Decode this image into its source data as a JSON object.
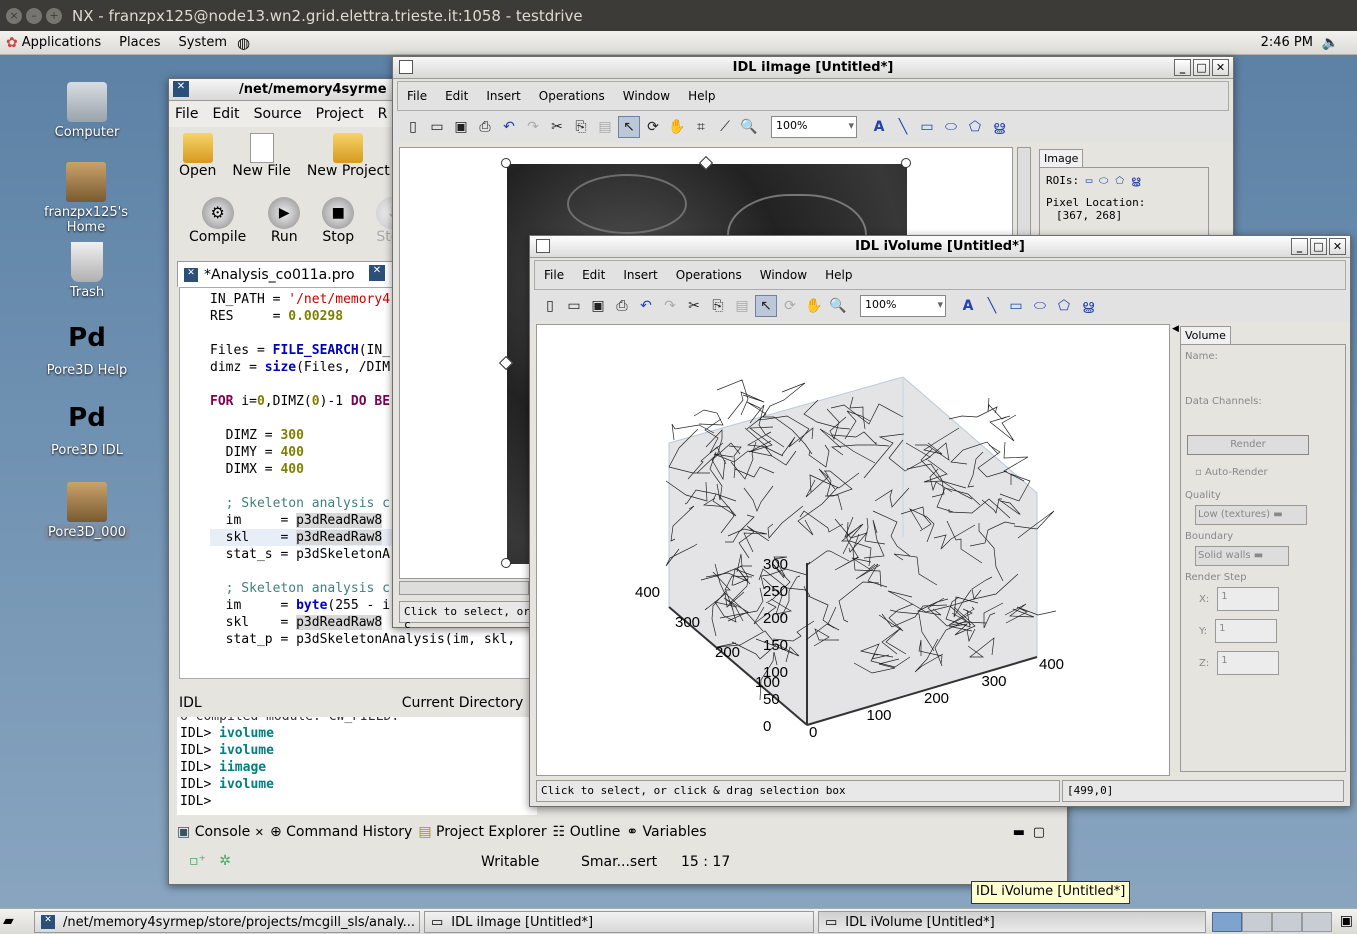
{
  "nx": {
    "title": "NX - franzpx125@node13.wn2.grid.elettra.trieste.it:1058 - testdrive"
  },
  "topbar": {
    "menus": [
      "Applications",
      "Places",
      "System"
    ],
    "clock": "2:46 PM"
  },
  "desktop": {
    "icons": [
      "Computer",
      "franzpx125's Home",
      "Trash",
      "Pore3D Help",
      "Pore3D IDL",
      "Pore3D_000"
    ]
  },
  "eclipse": {
    "title": "/net/memory4syrme",
    "menus": [
      "File",
      "Edit",
      "Source",
      "Project",
      "R"
    ],
    "tools1": [
      "Open",
      "New File",
      "New Project"
    ],
    "tools2": [
      "Compile",
      "Run",
      "Stop",
      "Step"
    ],
    "tab": "*Analysis_co011a.pro",
    "code": {
      "l1a": "IN_PATH = ",
      "l1b": "'/net/memory4",
      "l2a": "RES     = ",
      "l2b": "0.00298",
      "l3a": "Files = ",
      "l3b": "FILE_SEARCH",
      "l3c": "(IN_",
      "l4a": "dimz = ",
      "l4b": "size",
      "l4c": "(Files, /DIM",
      "l5a": "FOR",
      "l5b": " i=",
      "l5c": "0",
      ",l5d": "",
      "l5e": ",DIMZ(",
      "l5f": "0",
      "l5g": ")-1 ",
      "l5h": "DO BE",
      "l6a": "  DIMZ = ",
      "l6b": "300",
      "l7a": "  DIMY = ",
      "l7b": "400",
      "l8a": "  DIMX = ",
      "l8b": "400",
      "l9": "  ; Skeleton analysis c",
      "l10a": "  im     = ",
      "l10b": "p3dReadRaw8",
      "l11a": "  skl    = ",
      "l11b": "p3dReadRaw8",
      "l12": "  stat_s = p3dSkeletonA",
      "l13": "  ; Skeleton analysis c",
      "l14a": "  im     = ",
      "l14b": "byte",
      "l14c": "(255 - i",
      "l15a": "  skl    = ",
      "l15b": "p3dReadRaw8",
      "l16": "  stat_p = p3dSkeletonAnalysis(im, skl,"
    },
    "console": {
      "label": "IDL",
      "curdir": "Current Directory",
      "cut": "6 compiled module: CW_FIELD.",
      "lines": [
        {
          "p": "IDL> ",
          "c": "ivolume"
        },
        {
          "p": "IDL> ",
          "c": "ivolume"
        },
        {
          "p": "IDL> ",
          "c": "iimage"
        },
        {
          "p": "IDL> ",
          "c": "ivolume"
        },
        {
          "p": "IDL>",
          "c": ""
        }
      ]
    },
    "tabs": [
      "Console",
      "Command History",
      "Project Explorer",
      "Outline",
      "Variables"
    ],
    "status": {
      "mode": "Writable",
      "insert": "Smar...sert",
      "pos": "15 : 17"
    }
  },
  "iimage": {
    "title": "IDL iImage [Untitled*]",
    "menus": [
      "File",
      "Edit",
      "Insert",
      "Operations",
      "Window",
      "Help"
    ],
    "zoom": "100%",
    "panel": {
      "tab": "Image",
      "rois": "ROIs:",
      "pixloc": "Pixel Location:",
      "pixval": "[367, 268]"
    },
    "status": "Click to select, or c"
  },
  "ivolume": {
    "title": "IDL iVolume [Untitled*]",
    "menus": [
      "File",
      "Edit",
      "Insert",
      "Operations",
      "Window",
      "Help"
    ],
    "zoom": "100%",
    "panel": {
      "tab": "Volume",
      "name": "Name:",
      "datach": "Data Channels:",
      "render": "Render",
      "autorender": "Auto-Render",
      "quality": "Quality",
      "quality_val": "Low (textures)",
      "boundary": "Boundary",
      "boundary_val": "Solid walls",
      "renderstep": "Render Step",
      "x": "X:",
      "y": "Y:",
      "z": "Z:",
      "xv": "1",
      "yv": "1",
      "zv": "1"
    },
    "zticks": [
      "0",
      "50",
      "100",
      "150",
      "200",
      "250",
      "300"
    ],
    "xticks": [
      "0",
      "100",
      "200",
      "300",
      "400"
    ],
    "yticks": [
      "100",
      "200",
      "300",
      "400"
    ],
    "status": "Click to select, or click & drag selection box",
    "coord": "[499,0]"
  },
  "tooltip": "IDL iVolume [Untitled*]",
  "taskbar": {
    "items": [
      "/net/memory4syrmep/store/projects/mcgill_sls/analy...",
      "IDL iImage [Untitled*]",
      "IDL iVolume [Untitled*]"
    ]
  }
}
